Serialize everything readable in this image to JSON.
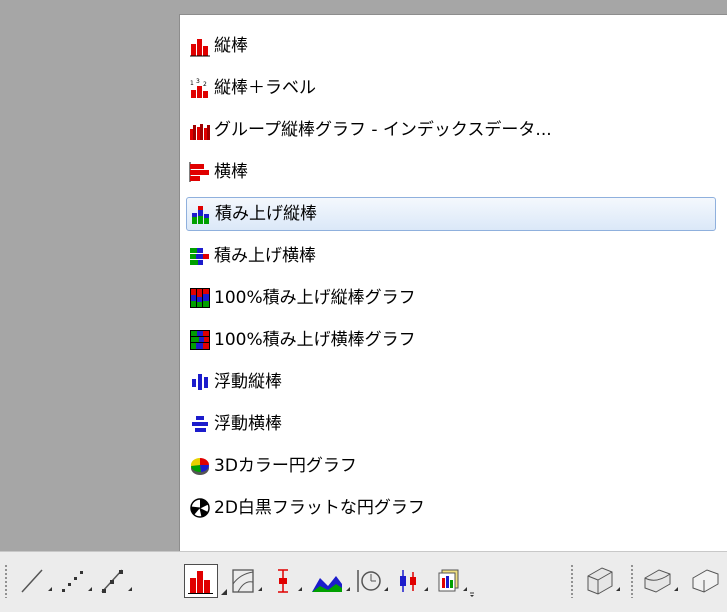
{
  "menu": {
    "items": [
      {
        "label": "縦棒",
        "icon": "column-chart-icon"
      },
      {
        "label": "縦棒＋ラベル",
        "icon": "column-label-chart-icon"
      },
      {
        "label": "グループ縦棒グラフ - インデックスデータ...",
        "icon": "grouped-column-chart-icon"
      },
      {
        "label": "横棒",
        "icon": "bar-chart-icon"
      },
      {
        "label": "積み上げ縦棒",
        "icon": "stacked-column-chart-icon",
        "highlighted": true
      },
      {
        "label": "積み上げ横棒",
        "icon": "stacked-bar-chart-icon"
      },
      {
        "label": "100%積み上げ縦棒グラフ",
        "icon": "percent-stacked-column-chart-icon"
      },
      {
        "label": "100%積み上げ横棒グラフ",
        "icon": "percent-stacked-bar-chart-icon"
      },
      {
        "label": "浮動縦棒",
        "icon": "floating-column-chart-icon"
      },
      {
        "label": "浮動横棒",
        "icon": "floating-bar-chart-icon"
      },
      {
        "label": "3Dカラー円グラフ",
        "icon": "3d-color-pie-chart-icon"
      },
      {
        "label": "2D白黒フラットな円グラフ",
        "icon": "2d-bw-pie-chart-icon"
      }
    ]
  },
  "toolbar": {
    "buttons": [
      {
        "icon": "line-plot-icon"
      },
      {
        "icon": "scatter-plot-icon"
      },
      {
        "icon": "line-symbol-plot-icon"
      },
      {
        "icon": "column-bar-plot-icon",
        "pressed": true
      },
      {
        "icon": "contour-plot-icon"
      },
      {
        "icon": "error-bar-plot-icon"
      },
      {
        "icon": "area-plot-icon"
      },
      {
        "icon": "polar-plot-icon"
      },
      {
        "icon": "box-stock-plot-icon"
      },
      {
        "icon": "template-library-icon"
      },
      {
        "icon": "3d-bar-icon"
      },
      {
        "icon": "3d-surface-icon"
      }
    ]
  },
  "colors": {
    "red": "#e00000",
    "blue": "#1c1ccc",
    "green": "#00a000",
    "highlight_border": "#8fb0dd"
  }
}
